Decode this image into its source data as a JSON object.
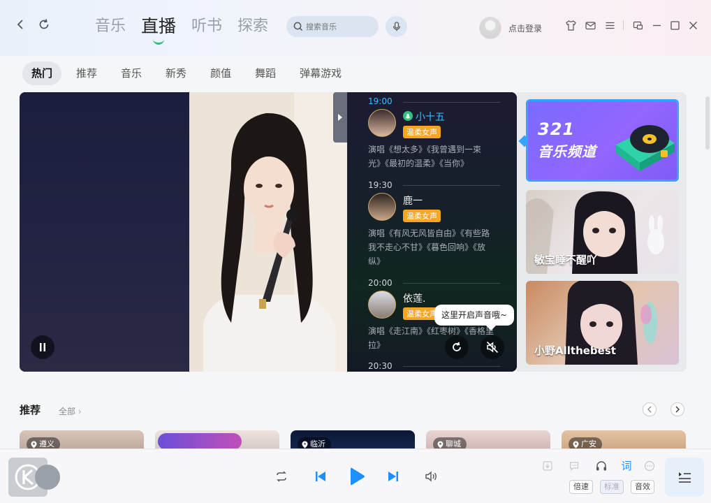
{
  "titlebar": {
    "tabs": [
      {
        "label": "音乐",
        "active": false
      },
      {
        "label": "直播",
        "active": true
      },
      {
        "label": "听书",
        "active": false
      },
      {
        "label": "探索",
        "active": false
      }
    ],
    "search_placeholder": "搜索音乐",
    "login_label": "点击登录"
  },
  "sub_tabs": [
    {
      "label": "热门",
      "active": true
    },
    {
      "label": "推荐",
      "active": false
    },
    {
      "label": "音乐",
      "active": false
    },
    {
      "label": "新秀",
      "active": false
    },
    {
      "label": "颜值",
      "active": false
    },
    {
      "label": "舞蹈",
      "active": false
    },
    {
      "label": "弹幕游戏",
      "active": false
    }
  ],
  "schedule": [
    {
      "time": "19:00",
      "name": "小十五",
      "badge": "温柔女声",
      "songs": "演唱《想太多》《我曾遇到一束光》《最初的温柔》《当你》",
      "live": true
    },
    {
      "time": "19:30",
      "name": "鹿一",
      "badge": "温柔女声",
      "songs": "演唱《有风无风皆自由》《有些路我不走心不甘》《暮色回响》《放纵》",
      "live": false
    },
    {
      "time": "20:00",
      "name": "依莲.",
      "badge": "温柔女声",
      "songs": "演唱《走江南》《红枣树》《香格里拉》",
      "live": false
    },
    {
      "time": "20:30",
      "name": "",
      "badge": "",
      "songs": "",
      "live": false
    }
  ],
  "tooltip": "这里开启声音哦~",
  "side_cards": {
    "channel": {
      "number": "321",
      "title": "音乐频道"
    },
    "streamers": [
      {
        "name": "敏宝睡不醒吖"
      },
      {
        "name": "小野Allthebest"
      }
    ]
  },
  "recommend": {
    "title": "推荐",
    "all_label": "全部",
    "cards": [
      {
        "location": "遵义"
      },
      {
        "location": ""
      },
      {
        "location": "临沂"
      },
      {
        "location": "聊城"
      },
      {
        "location": "广安"
      }
    ]
  },
  "player": {
    "lyrics_label": "词",
    "speed_label": "倍速",
    "quality_label": "标准",
    "effect_label": "音效"
  },
  "colors": {
    "accent": "#31c27c",
    "play_blue": "#1f8fff",
    "live_blue": "#31c2ff",
    "badge_orange": "#f5a623",
    "channel_purple": "#8a64ff"
  }
}
